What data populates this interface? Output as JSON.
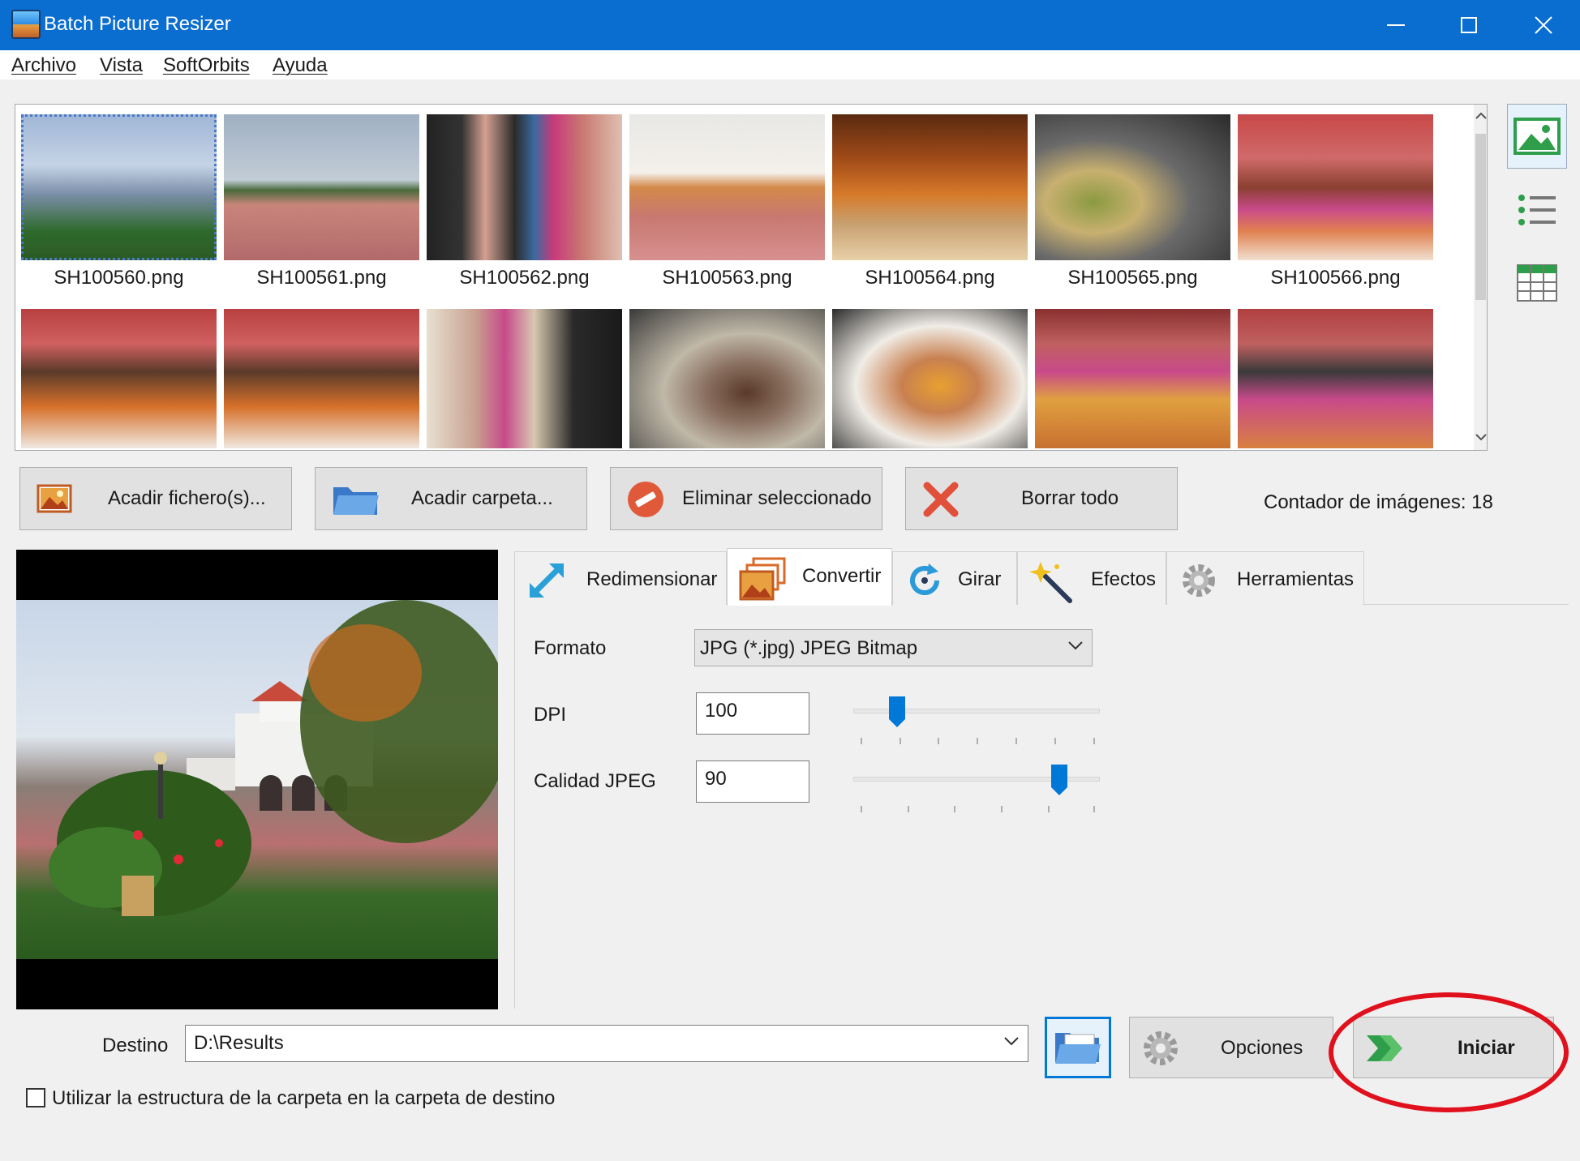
{
  "window": {
    "title": "Batch Picture Resizer"
  },
  "menu": [
    "Archivo",
    "Vista",
    "SoftOrbits",
    "Ayuda"
  ],
  "thumbnails": {
    "row1": [
      "SH100560.png",
      "SH100561.png",
      "SH100562.png",
      "SH100563.png",
      "SH100564.png",
      "SH100565.png",
      "SH100566.png"
    ]
  },
  "actions": {
    "add_files": "Acadir fichero(s)...",
    "add_folder": "Acadir carpeta...",
    "remove_selected": "Eliminar seleccionado",
    "clear_all": "Borrar todo",
    "counter": "Contador de imágenes: 18"
  },
  "tabs": [
    "Redimensionar",
    "Convertir",
    "Girar",
    "Efectos",
    "Herramientas"
  ],
  "active_tab": "Convertir",
  "convert": {
    "format_label": "Formato",
    "format_value": "JPG (*.jpg) JPEG Bitmap",
    "dpi_label": "DPI",
    "dpi_value": "100",
    "dpi_slider_fraction": 0.13,
    "quality_label": "Calidad JPEG",
    "quality_value": "90",
    "quality_slider_fraction": 0.87
  },
  "destination": {
    "label": "Destino",
    "value": "D:\\Results",
    "options_label": "Opciones",
    "start_label": "Iniciar",
    "folder_structure_label": "Utilizar la estructura de la carpeta en la carpeta de destino",
    "folder_structure_checked": false
  },
  "colors": {
    "titlebar": "#0a6ed1",
    "accent": "#0078d7",
    "highlight_circle": "#e0101c"
  }
}
